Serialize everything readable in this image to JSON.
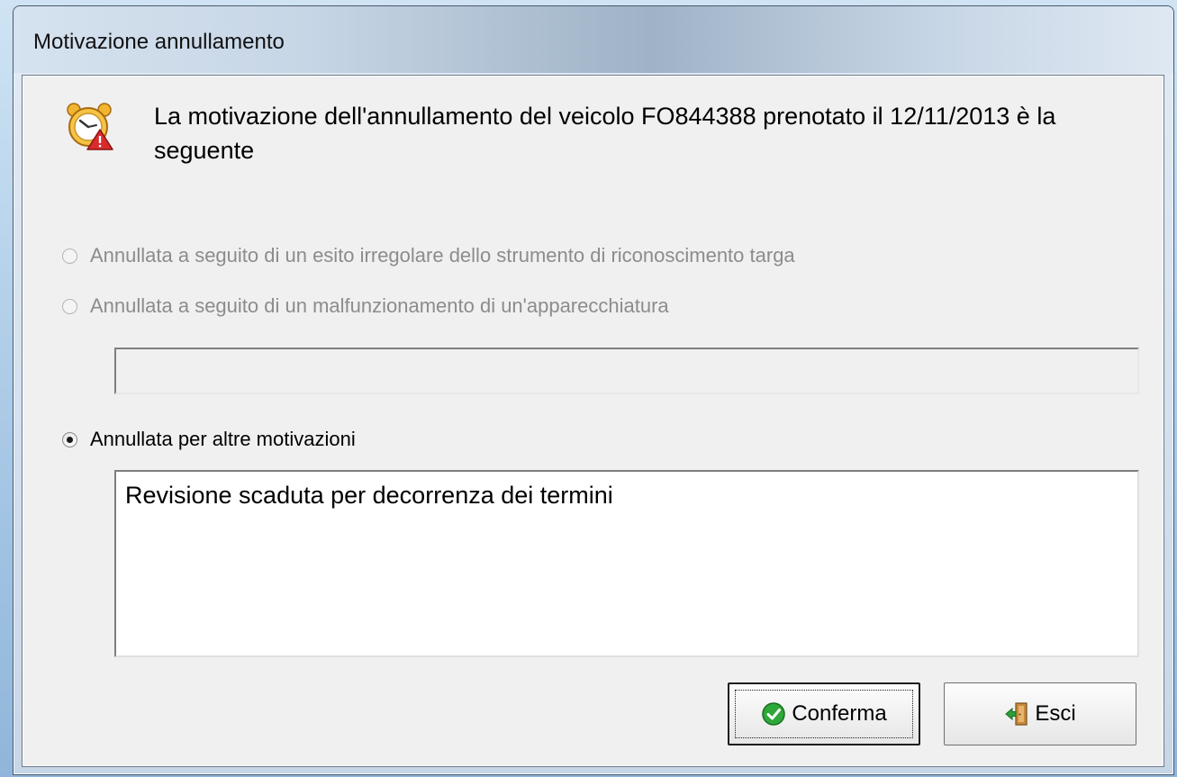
{
  "window": {
    "title": "Motivazione annullamento"
  },
  "header": {
    "message": "La motivazione dell'annullamento del veicolo FO844388 prenotato il 12/11/2013 è la seguente",
    "icon": "alarm-clock-warning-icon"
  },
  "options": [
    {
      "label": "Annullata a seguito di un esito irregolare dello strumento di riconoscimento targa",
      "checked": false,
      "enabled": false
    },
    {
      "label": "Annullata a seguito di un malfunzionamento di un'apparecchiatura",
      "checked": false,
      "enabled": false
    },
    {
      "label": "Annullata per altre motivazioni",
      "checked": true,
      "enabled": true
    }
  ],
  "equipment_field": {
    "value": ""
  },
  "reason_text": "Revisione scaduta per decorrenza dei termini",
  "buttons": {
    "confirm": {
      "label": "Conferma",
      "icon": "green-check-icon"
    },
    "exit": {
      "label": "Esci",
      "icon": "exit-door-icon"
    }
  }
}
